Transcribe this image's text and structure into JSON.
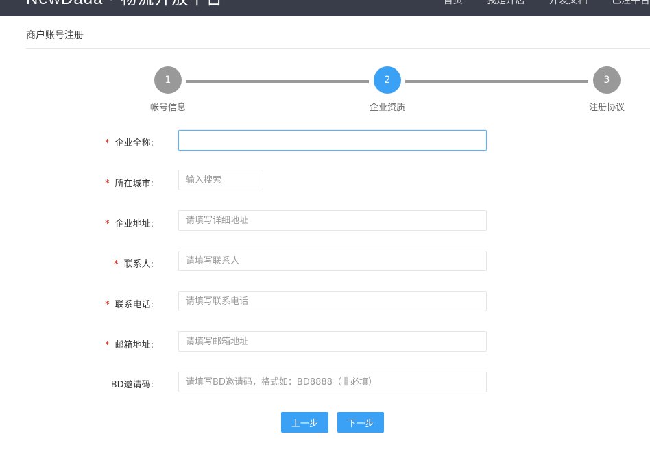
{
  "header": {
    "brand": "NewDada",
    "subtitle": "物流开放平台",
    "nav": [
      "首页",
      "我是开店",
      "开发文档",
      "已注平台"
    ]
  },
  "page_title": "商户账号注册",
  "steps": [
    {
      "number": "1",
      "label": "帐号信息",
      "color": "#999999"
    },
    {
      "number": "2",
      "label": "企业资质",
      "color": "#3aa1f5"
    },
    {
      "number": "3",
      "label": "注册协议",
      "color": "#999999"
    }
  ],
  "form": {
    "required_mark": "*",
    "company_name": {
      "label": "企业全称:",
      "placeholder": "",
      "value": ""
    },
    "city": {
      "label": "所在城市:",
      "placeholder": "输入搜索"
    },
    "address": {
      "label": "企业地址:",
      "placeholder": "请填写详细地址"
    },
    "contact": {
      "label": "联系人:",
      "placeholder": "请填写联系人"
    },
    "phone": {
      "label": "联系电话:",
      "placeholder": "请填写联系电话"
    },
    "email": {
      "label": "邮箱地址:",
      "placeholder": "请填写邮箱地址"
    },
    "bd_code": {
      "label": "BD邀请码:",
      "placeholder": "请填写BD邀请码，格式如：BD8888（非必填）"
    }
  },
  "buttons": {
    "prev": "上一步",
    "next": "下一步"
  },
  "colors": {
    "accent": "#3aa1f5",
    "inactive": "#999999",
    "required": "#e2231a",
    "topbar": "#393d49"
  }
}
